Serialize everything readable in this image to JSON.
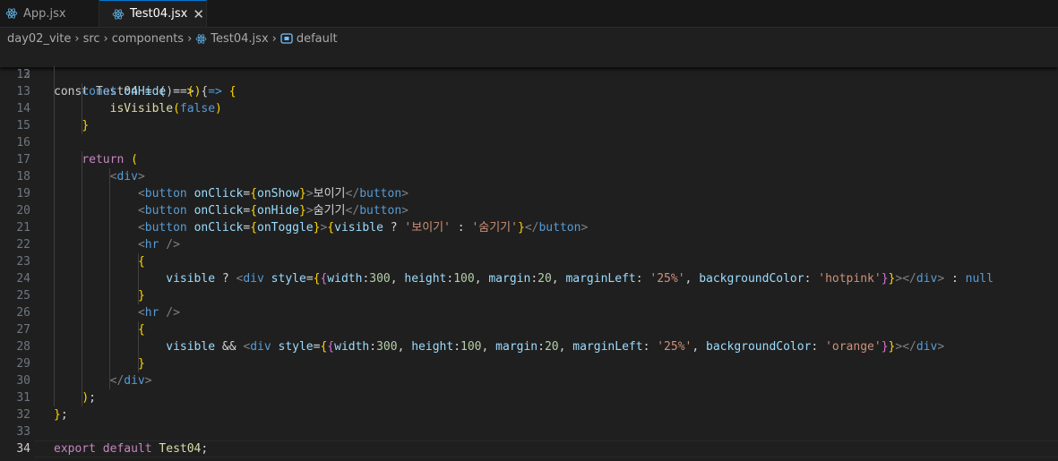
{
  "tabs": [
    {
      "label": "App.jsx",
      "active": false,
      "icon": "react-icon"
    },
    {
      "label": "Test04.jsx",
      "active": true,
      "icon": "react-icon",
      "close": "✕"
    }
  ],
  "breadcrumb": {
    "items": [
      "day02_vite",
      "src",
      "components",
      "Test04.jsx",
      "default"
    ],
    "separator": "›"
  },
  "colors": {
    "background": "#1f1f1f",
    "keyword": "#569cd6",
    "function": "#dcdcaa",
    "variable": "#9cdcfe",
    "string": "#ce9178",
    "number": "#b5cea8",
    "bracket_gold": "#ffd700",
    "bracket_purple": "#da70d6",
    "bracket_blue": "#179fff"
  },
  "editor": {
    "sticky_line": {
      "number": "3",
      "text": "const Test04 = () => {"
    },
    "current_line": "34",
    "lines": [
      {
        "number": "12",
        "text": ""
      },
      {
        "number": "13",
        "text": "    const onHide = () => {"
      },
      {
        "number": "14",
        "text": "        isVisible(false)"
      },
      {
        "number": "15",
        "text": "    }"
      },
      {
        "number": "16",
        "text": ""
      },
      {
        "number": "17",
        "text": "    return ("
      },
      {
        "number": "18",
        "text": "        <div>"
      },
      {
        "number": "19",
        "text": "            <button onClick={onShow}>보이기</button>"
      },
      {
        "number": "20",
        "text": "            <button onClick={onHide}>숨기기</button>"
      },
      {
        "number": "21",
        "text": "            <button onClick={onToggle}>{visible ? '보이기' : '숨기기'}</button>"
      },
      {
        "number": "22",
        "text": "            <hr />"
      },
      {
        "number": "23",
        "text": "            {"
      },
      {
        "number": "24",
        "text": "                visible ? <div style={{width:300, height:100, margin:20, marginLeft: '25%', backgroundColor: 'hotpink'}}></div> : null"
      },
      {
        "number": "25",
        "text": "            }"
      },
      {
        "number": "26",
        "text": "            <hr />"
      },
      {
        "number": "27",
        "text": "            {"
      },
      {
        "number": "28",
        "text": "                visible && <div style={{width:300, height:100, margin:20, marginLeft: '25%', backgroundColor: 'orange'}}></div>"
      },
      {
        "number": "29",
        "text": "            }"
      },
      {
        "number": "30",
        "text": "        </div>"
      },
      {
        "number": "31",
        "text": "    );"
      },
      {
        "number": "32",
        "text": "};"
      },
      {
        "number": "33",
        "text": ""
      },
      {
        "number": "34",
        "text": "export default Test04;"
      }
    ]
  }
}
